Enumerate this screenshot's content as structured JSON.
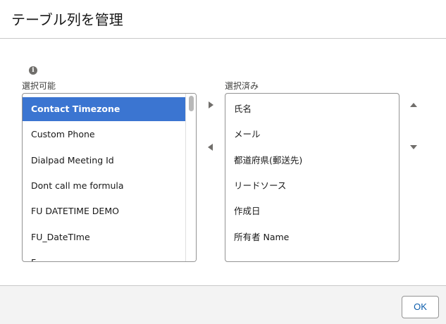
{
  "dialog": {
    "title": "テーブル列を管理"
  },
  "available": {
    "label": "選択可能",
    "items": [
      "Contact Timezone",
      "Custom Phone",
      "Dialpad Meeting Id",
      "Dont call me formula",
      "FU DATETIME DEMO",
      "FU_DateTIme",
      "F..."
    ],
    "selected_index": 0
  },
  "selected": {
    "label": "選択済み",
    "items": [
      "氏名",
      "メール",
      "都道府県(郵送先)",
      "リードソース",
      "作成日",
      "所有者 Name"
    ]
  },
  "icons": {
    "info": "info-icon",
    "move_right": "triangle-right-icon",
    "move_left": "triangle-left-icon",
    "move_up": "triangle-up-icon",
    "move_down": "triangle-down-icon"
  },
  "colors": {
    "selection": "#3b75d1",
    "ok_text": "#0b5cab",
    "footer_bg": "#f3f3f3"
  },
  "footer": {
    "ok_label": "OK"
  }
}
